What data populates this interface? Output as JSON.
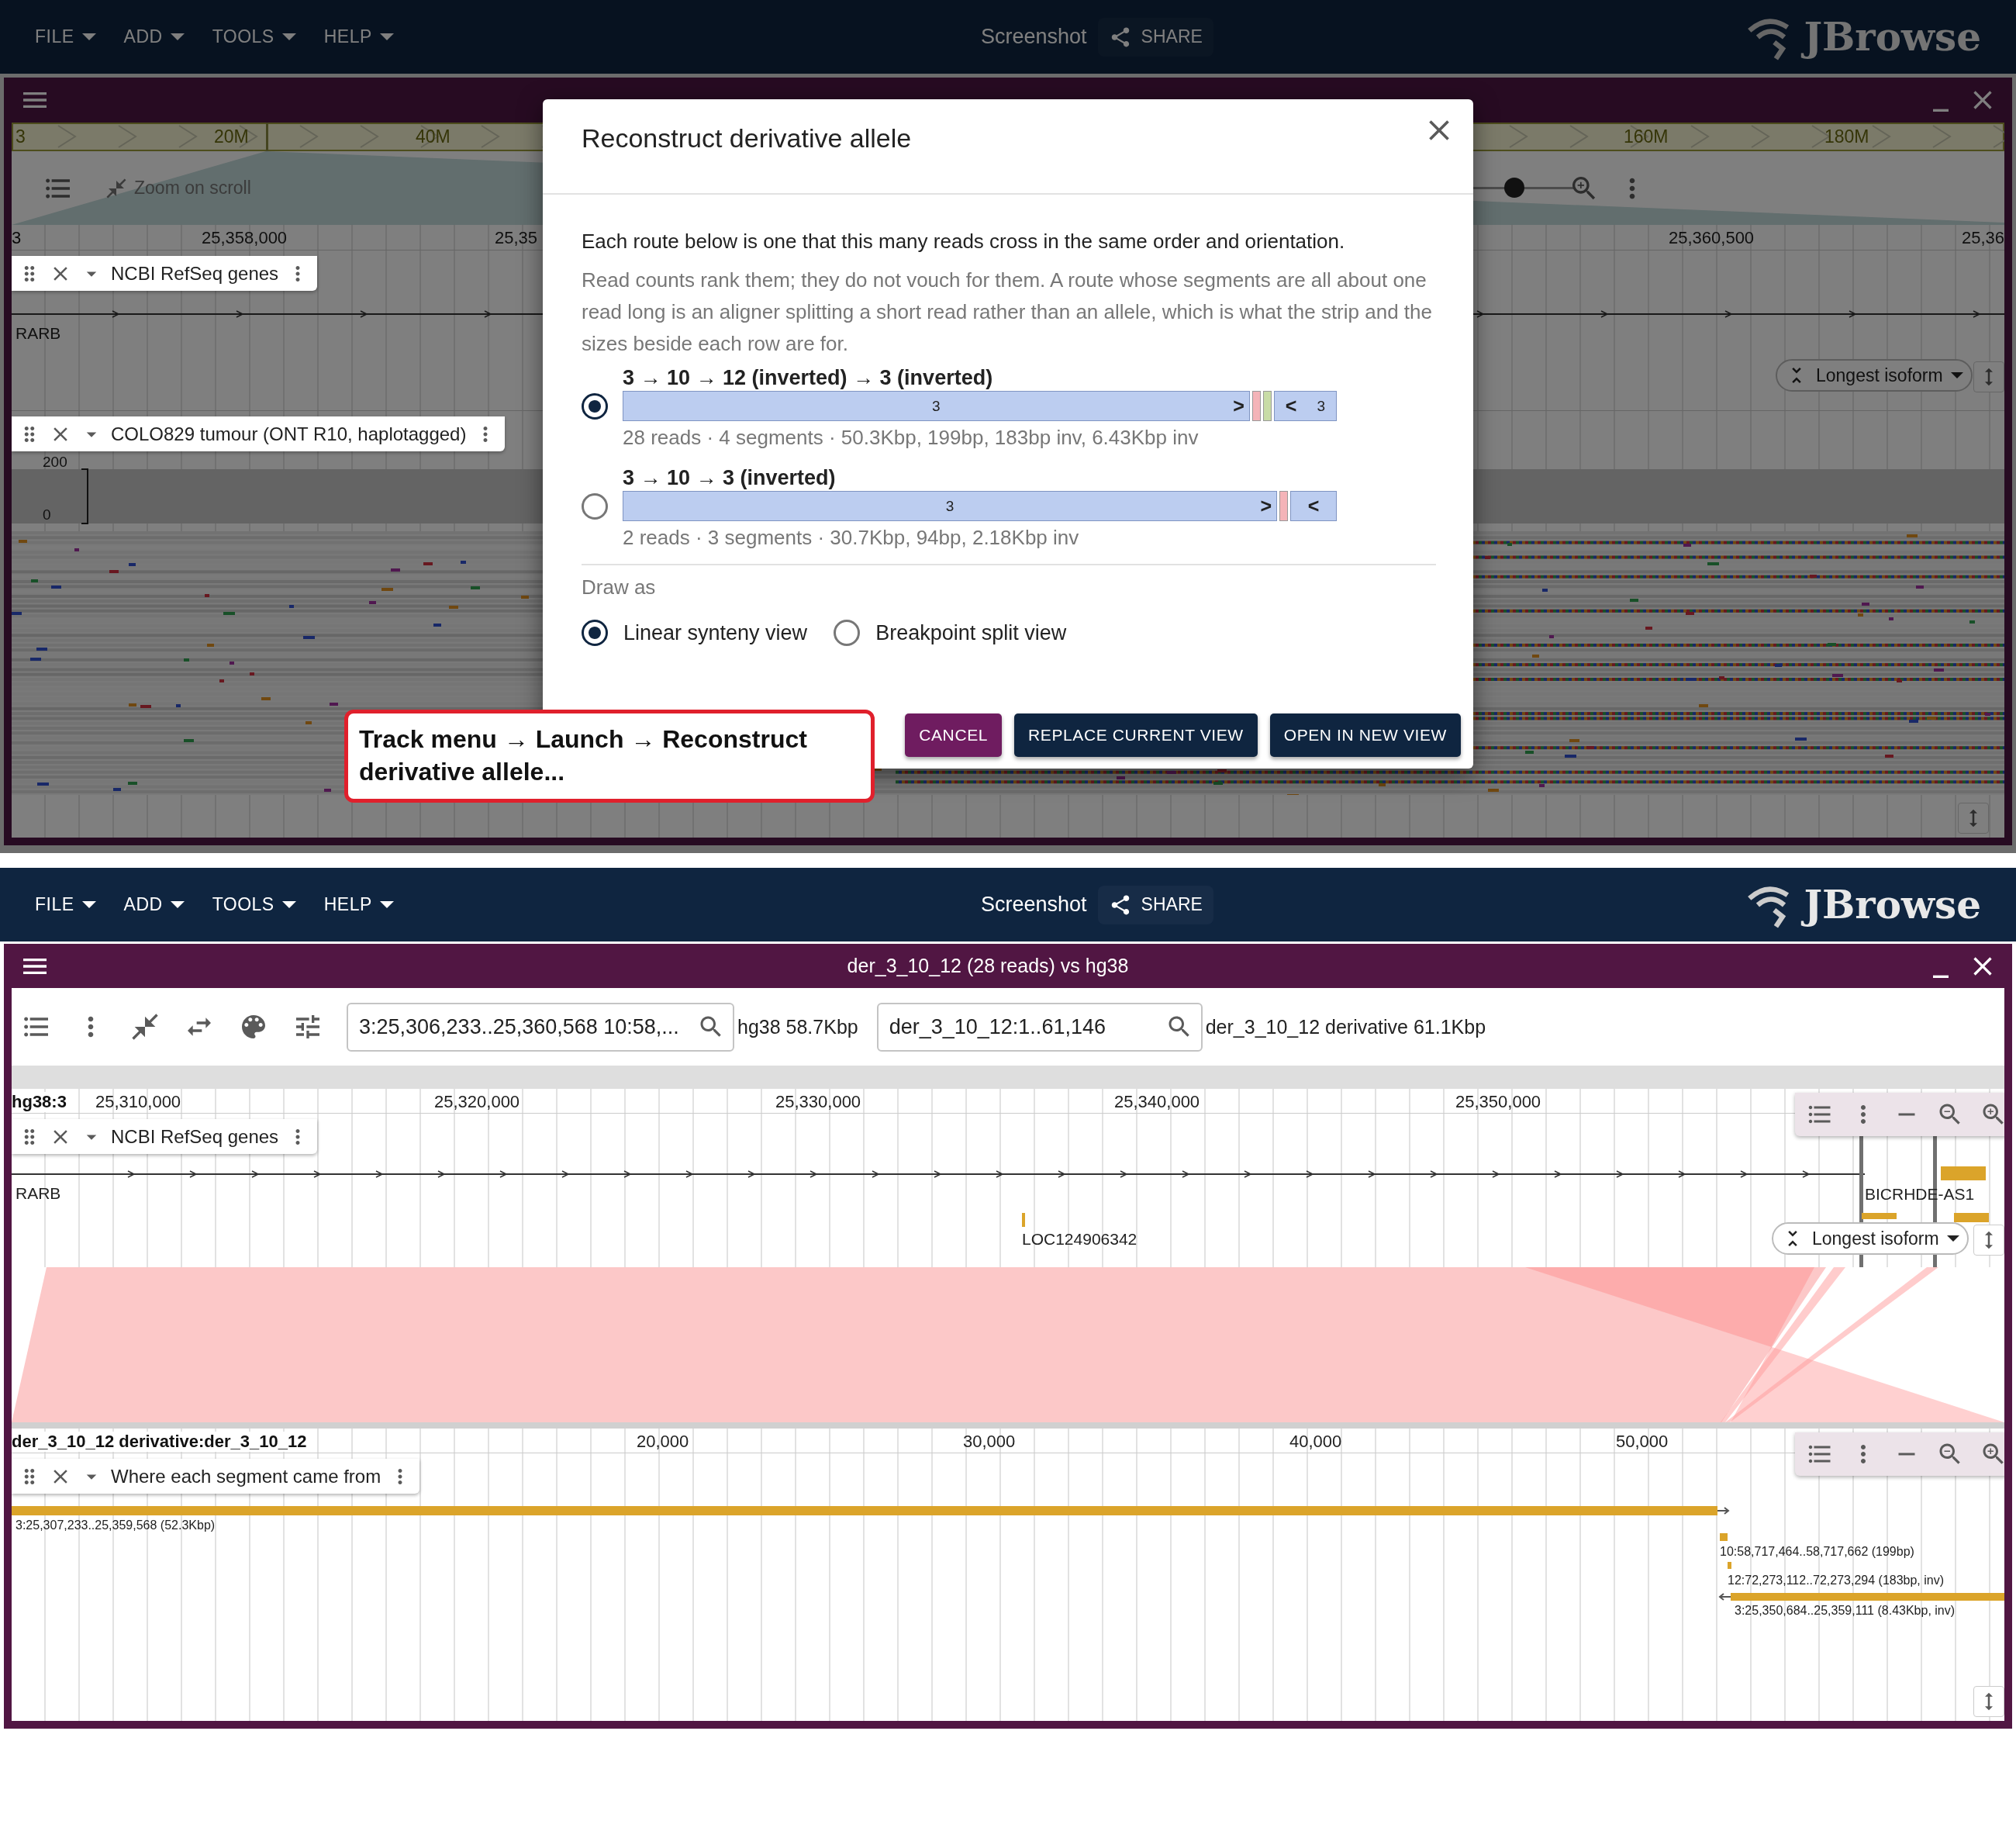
{
  "top_screen": {
    "appbar": {
      "menus": [
        "FILE",
        "ADD",
        "TOOLS",
        "HELP"
      ],
      "screenshot": "Screenshot",
      "share": "SHARE",
      "logo": "JBrowse"
    },
    "view": {
      "overview": {
        "labels": [
          "3",
          "20M",
          "40M",
          "160M",
          "180M"
        ]
      },
      "zoom_on_scroll": "Zoom on scroll",
      "zoom": {
        "level": 0.86
      },
      "ruler": {
        "chromosome": "3",
        "ticks": [
          "25,358,000",
          "25,35",
          "25,360,500",
          "25,36"
        ]
      },
      "gene_track": {
        "label": "NCBI RefSeq genes",
        "features": [
          "RARB"
        ],
        "isoform_button": "Longest isoform"
      },
      "reads_track": {
        "label": "COLO829 tumour (ONT R10, haplotagged)",
        "scale": [
          "200",
          "0"
        ]
      }
    },
    "dialog": {
      "title": "Reconstruct derivative allele",
      "lead": "Each route below is one that this many reads cross in the same order and orientation.",
      "note": "Read counts rank them; they do not vouch for them. A route whose segments are all about one read long is an aligner splitting a short read rather than an allele, which is what the strip and the sizes beside each row are for.",
      "routes": [
        {
          "title": "3 → 10 → 12 (inverted) → 3 (inverted)",
          "selected": true,
          "stats": "28 reads · 4 segments · 50.3Kbp, 199bp, 183bp inv, 6.43Kbp inv",
          "segments": [
            {
              "kind": "long",
              "color": "#bccdf0",
              "label": "3",
              "arrow": ">"
            },
            {
              "kind": "tick",
              "color": "#f4b4b8"
            },
            {
              "kind": "tick",
              "color": "#c8dca6"
            },
            {
              "kind": "tail",
              "color": "#bccdf0",
              "arrow": "<",
              "label": "3"
            }
          ]
        },
        {
          "title": "3 → 10 → 3 (inverted)",
          "selected": false,
          "stats": "2 reads · 3 segments · 30.7Kbp, 94bp, 2.18Kbp inv",
          "segments": [
            {
              "kind": "long",
              "color": "#bccdf0",
              "label": "3",
              "arrow": ">"
            },
            {
              "kind": "tick",
              "color": "#f4b4b8"
            },
            {
              "kind": "tail",
              "color": "#bccdf0",
              "arrow": "<"
            }
          ]
        }
      ],
      "draw_as": {
        "label": "Draw as",
        "options": [
          {
            "label": "Linear synteny view",
            "selected": true
          },
          {
            "label": "Breakpoint split view",
            "selected": false
          }
        ]
      },
      "buttons": [
        {
          "label": "CANCEL",
          "kind": "secondary"
        },
        {
          "label": "REPLACE CURRENT VIEW",
          "kind": "primary"
        },
        {
          "label": "OPEN IN NEW VIEW",
          "kind": "primary"
        }
      ]
    },
    "callout": "Track menu → Launch → Reconstruct derivative allele..."
  },
  "bottom_screen": {
    "appbar": {
      "menus": [
        "FILE",
        "ADD",
        "TOOLS",
        "HELP"
      ],
      "screenshot": "Screenshot",
      "share": "SHARE",
      "logo": "JBrowse"
    },
    "view": {
      "title": "der_3_10_12 (28 reads) vs hg38",
      "locations": [
        {
          "value": "3:25,306,233..25,360,568 10:58,...",
          "assembly": "hg38 58.7Kbp"
        },
        {
          "value": "der_3_10_12:1..61,146",
          "assembly": "der_3_10_12 derivative 61.1Kbp"
        }
      ],
      "top_ruler": {
        "name": "hg38:3",
        "ticks": [
          "25,310,000",
          "25,320,000",
          "25,330,000",
          "25,340,000",
          "25,350,000"
        ]
      },
      "gene_track": {
        "label": "NCBI RefSeq genes",
        "features": [
          "RARB",
          "LOC124906342",
          "BICRHDE-AS1"
        ],
        "isoform_button": "Longest isoform"
      },
      "bottom_ruler": {
        "name": "der_3_10_12 derivative:der_3_10_12",
        "ticks": [
          "20,000",
          "30,000",
          "40,000",
          "50,000"
        ]
      },
      "segment_track": {
        "label": "Where each segment came from",
        "segments": [
          {
            "label": "3:25,307,233..25,359,568 (52.3Kbp)",
            "kind": "forward"
          },
          {
            "label": "10:58,717,464..58,717,662 (199bp)",
            "kind": "block"
          },
          {
            "label": "12:72,273,112..72,273,294 (183bp, inv)",
            "kind": "block"
          },
          {
            "label": "3:25,350,684..25,359,111 (8.43Kbp, inv)",
            "kind": "reverse"
          }
        ]
      }
    }
  }
}
